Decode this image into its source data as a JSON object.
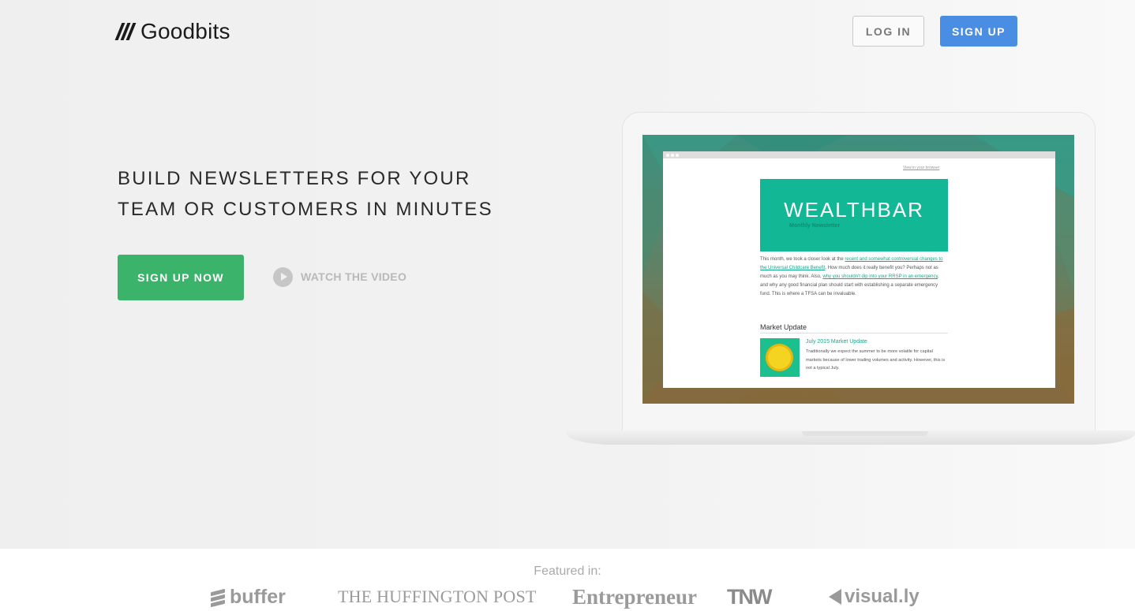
{
  "header": {
    "logo_text": "Goodbits",
    "login_label": "LOG IN",
    "signup_label": "SIGN UP"
  },
  "hero": {
    "headline_line1": "BUILD NEWSLETTERS FOR YOUR",
    "headline_line2": "TEAM OR CUSTOMERS IN MINUTES",
    "cta_label": "SIGN UP NOW",
    "video_label": "WATCH THE VIDEO"
  },
  "newsletter_preview": {
    "view_in_browser": "View in your browser",
    "brand": "WEALTHBAR",
    "subtitle": "Monthly Newsletter",
    "body_1": "This month, we took a closer look at the ",
    "body_link_1": "recent and somewhat controversial changes to the Universal Childcare Benefit",
    "body_2": ". How much does it really benefit you? Perhaps not as much as you may think. Also, ",
    "body_link_2": "why you shouldn't dip into your RRSP in an emergency",
    "body_3": ", and why any good financial plan should start with establishing a separate emergency fund. This is where a TFSA can be invaluable.",
    "section_title": "Market Update",
    "article_title": "July 2015 Market Update",
    "article_text": "Traditionally we expect the summer to be more volatile for capital markets because of lower trading volumes and activity. However, this is not a typical July."
  },
  "featured": {
    "label": "Featured in:",
    "logos": {
      "buffer": "buffer",
      "huffington": "THE HUFFINGTON POST",
      "entrepreneur": "Entrepreneur",
      "tnw": "TNW",
      "visually": "visual.ly"
    }
  },
  "colors": {
    "signup_blue": "#4a8ee4",
    "cta_green": "#3bb36a",
    "wealthbar_teal": "#12b896"
  }
}
